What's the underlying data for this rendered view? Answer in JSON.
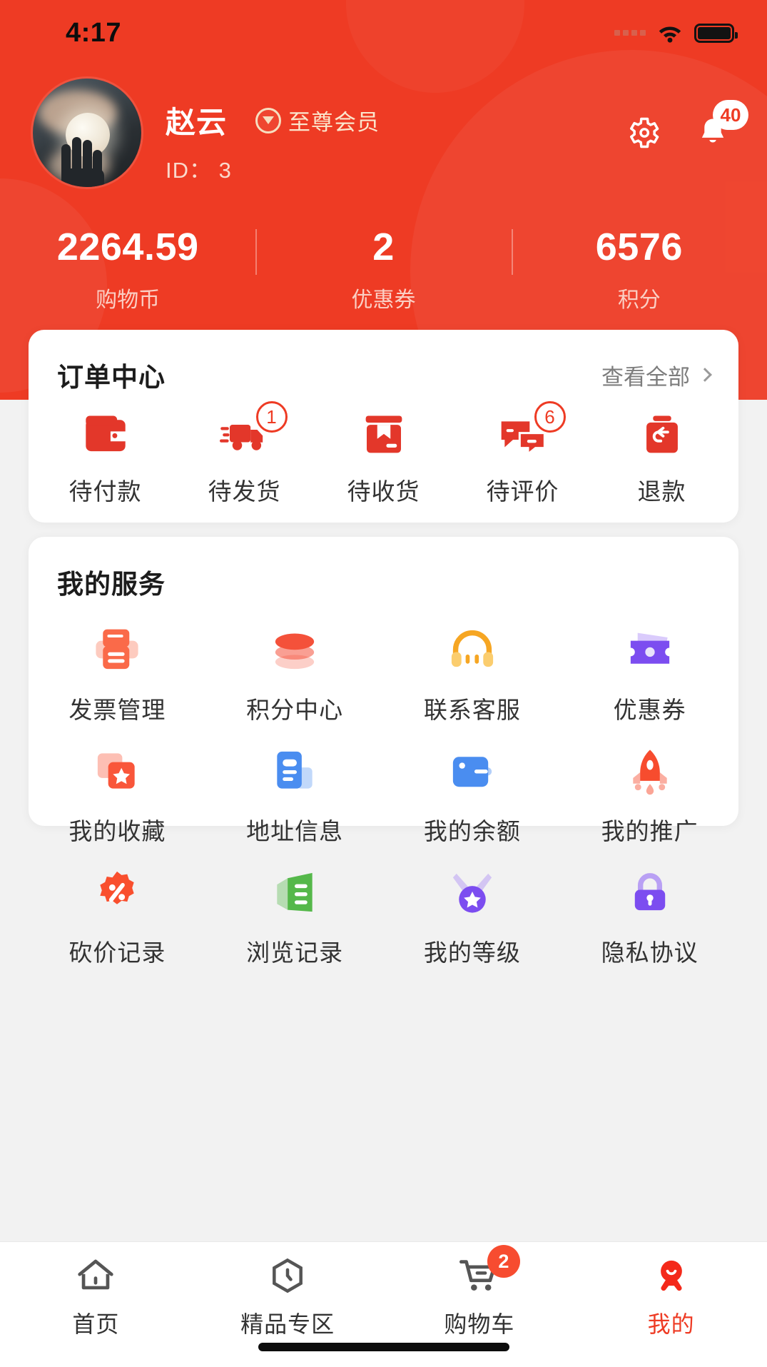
{
  "status_bar": {
    "time": "4:17",
    "signal_icon": "signal-dots-icon",
    "wifi_icon": "wifi-icon",
    "battery_icon": "battery-icon"
  },
  "header": {
    "background_color": "#ee3b24",
    "avatar": {
      "name": "user-avatar",
      "description": "hand-reaching-moon-photo"
    },
    "username": "赵云",
    "vip_label": "至尊会员",
    "vip_icon": "medal-icon",
    "user_id": "ID： 3",
    "settings_icon": "gear-icon",
    "notifications_icon": "bell-icon",
    "notifications_count": "40",
    "stats": [
      {
        "value": "2264.59",
        "label": "购物币"
      },
      {
        "value": "2",
        "label": "优惠券"
      },
      {
        "value": "6576",
        "label": "积分"
      }
    ]
  },
  "orders_card": {
    "title": "订单中心",
    "view_all": "查看全部",
    "chevron_icon": "chevron-right-icon",
    "items": [
      {
        "label": "待付款",
        "icon": "wallet-icon",
        "badge": ""
      },
      {
        "label": "待发货",
        "icon": "truck-icon",
        "badge": "1"
      },
      {
        "label": "待收货",
        "icon": "package-box-icon",
        "badge": ""
      },
      {
        "label": "待评价",
        "icon": "chat-bubbles-icon",
        "badge": "6"
      },
      {
        "label": "退款",
        "icon": "refund-bag-icon",
        "badge": ""
      }
    ]
  },
  "services_card": {
    "title": "我的服务",
    "items": [
      {
        "label": "发票管理",
        "icon": "invoice-printer-icon",
        "color": "#fa6a49"
      },
      {
        "label": "积分中心",
        "icon": "coin-stack-icon",
        "color": "#f4513a"
      },
      {
        "label": "联系客服",
        "icon": "headset-icon",
        "color": "#f6a623"
      },
      {
        "label": "优惠券",
        "icon": "coupon-ticket-icon",
        "color": "#8b5cf6"
      },
      {
        "label": "我的收藏",
        "icon": "star-card-icon",
        "color": "#f9563a"
      },
      {
        "label": "地址信息",
        "icon": "address-document-icon",
        "color": "#4a8df0"
      },
      {
        "label": "我的余额",
        "icon": "balance-wallet-icon",
        "color": "#4a8df0"
      },
      {
        "label": "我的推广",
        "icon": "rocket-icon",
        "color": "#f74c2e"
      },
      {
        "label": "砍价记录",
        "icon": "percent-badge-icon",
        "color": "#f94f2e"
      },
      {
        "label": "浏览记录",
        "icon": "history-book-icon",
        "color": "#55b84a"
      },
      {
        "label": "我的等级",
        "icon": "medal-star-icon",
        "color": "#8b5cf6"
      },
      {
        "label": "隐私协议",
        "icon": "lock-icon",
        "color": "#8b5cf6"
      }
    ]
  },
  "tab_bar": {
    "active_color": "#ee3b24",
    "items": [
      {
        "label": "首页",
        "icon": "home-icon",
        "badge": "",
        "active": false
      },
      {
        "label": "精品专区",
        "icon": "hexagon-clock-icon",
        "badge": "",
        "active": false
      },
      {
        "label": "购物车",
        "icon": "shopping-cart-icon",
        "badge": "2",
        "active": false
      },
      {
        "label": "我的",
        "icon": "user-profile-icon",
        "badge": "",
        "active": true
      }
    ]
  }
}
